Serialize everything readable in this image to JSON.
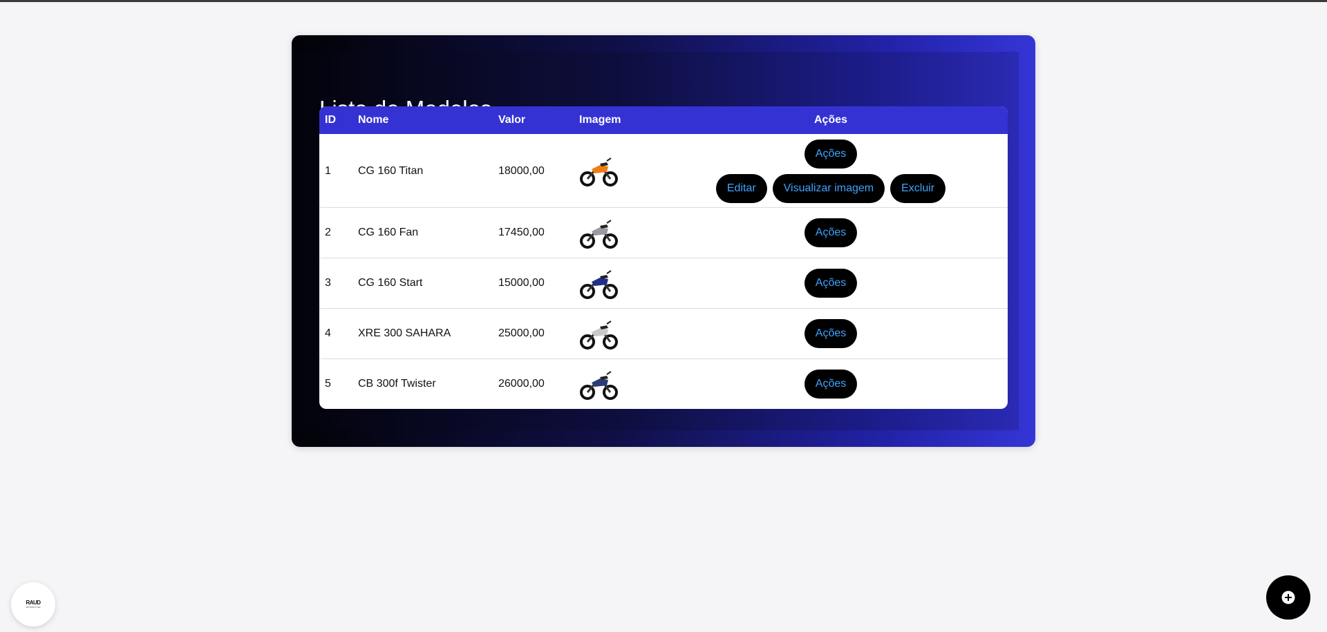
{
  "page": {
    "title": "Lista de Modelos"
  },
  "table": {
    "headers": {
      "id": "ID",
      "nome": "Nome",
      "valor": "Valor",
      "imagem": "Imagem",
      "acoes": "Ações"
    },
    "rows": [
      {
        "id": "1",
        "nome": "CG 160 Titan",
        "valor": "18000,00",
        "moto_color": "#f07d12",
        "actions_label": "Ações"
      },
      {
        "id": "2",
        "nome": "CG 160 Fan",
        "valor": "17450,00",
        "moto_color": "#9a9aa0",
        "actions_label": "Ações"
      },
      {
        "id": "3",
        "nome": "CG 160 Start",
        "valor": "15000,00",
        "moto_color": "#1f2f8a",
        "actions_label": "Ações"
      },
      {
        "id": "4",
        "nome": "XRE 300 SAHARA",
        "valor": "25000,00",
        "moto_color": "#c9c9cc",
        "actions_label": "Ações"
      },
      {
        "id": "5",
        "nome": "CB 300f Twister",
        "valor": "26000,00",
        "moto_color": "#2a3c78",
        "actions_label": "Ações"
      }
    ],
    "expanded_actions": {
      "edit": "Editar",
      "view_image": "Visualizar imagem",
      "delete": "Excluir"
    }
  },
  "logo": {
    "line1": "RAUD",
    "line2": "MOTORCYCLE"
  },
  "fab": {
    "icon": "plus-circle-icon"
  },
  "colors": {
    "header_bg": "#3532d4",
    "pill_bg": "#000000",
    "pill_text": "#3fa4ff"
  }
}
